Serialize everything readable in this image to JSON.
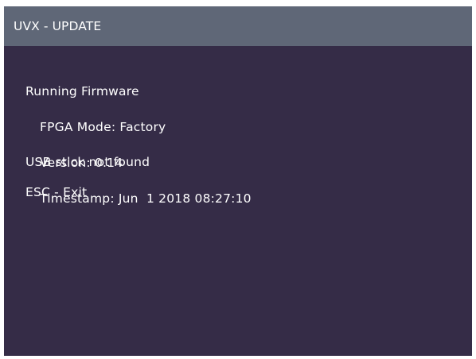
{
  "window": {
    "title": "UVX - UPDATE"
  },
  "firmware": {
    "heading": "Running Firmware",
    "fpga_mode": "FPGA Mode: Factory",
    "version": "Version: 0.14",
    "timestamp": "Timestamp: Jun  1 2018 08:27:10"
  },
  "status": {
    "usb_message": "USB stick not found"
  },
  "actions": {
    "exit_label": "ESC - Exit"
  },
  "colors": {
    "title_bar_bg": "#5f6777",
    "screen_bg": "#352c47",
    "text": "#ffffff"
  }
}
